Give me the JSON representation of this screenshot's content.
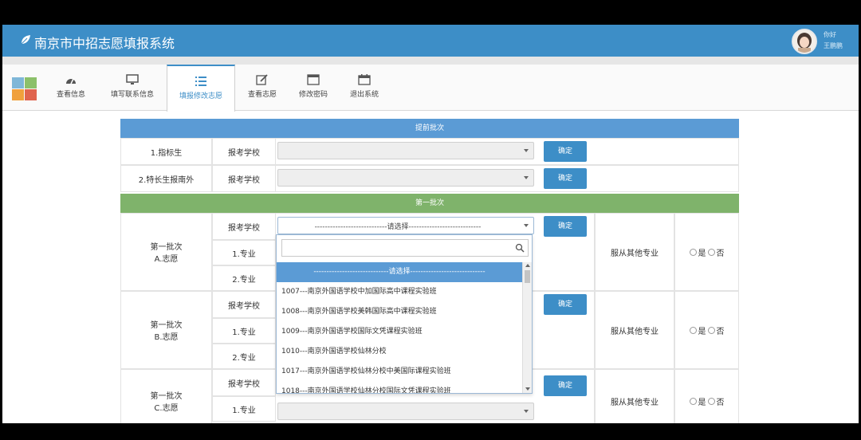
{
  "app": {
    "title": "南京市中招志愿填报系统",
    "user_line1": "你好",
    "user_line2": "王鹏鹏"
  },
  "nav": {
    "items": [
      {
        "label": "查看信息",
        "icon": "dashboard-icon"
      },
      {
        "label": "填写联系信息",
        "icon": "monitor-icon"
      },
      {
        "label": "填报修改志愿",
        "icon": "list-icon"
      },
      {
        "label": "查看志愿",
        "icon": "edit-icon"
      },
      {
        "label": "修改密码",
        "icon": "window-icon"
      },
      {
        "label": "退出系统",
        "icon": "calendar-icon"
      }
    ],
    "active_index": 2
  },
  "sections": {
    "advance": {
      "title": "提前批次",
      "rows": [
        {
          "label": "1.指标生",
          "field_label": "报考学校",
          "value": "",
          "button": "确定"
        },
        {
          "label": "2.特长生报南外",
          "field_label": "报考学校",
          "value": "",
          "button": "确定"
        }
      ]
    },
    "first_batch": {
      "title": "第一批次",
      "groups": [
        {
          "label_line1": "第一批次",
          "label_line2": "A.志愿",
          "school_label": "报考学校",
          "school_value": "----------------------------请选择----------------------------",
          "major1_label": "1.专业",
          "major2_label": "2.专业",
          "button": "确定",
          "obey_label": "服从其他专业",
          "yes": "是",
          "no": "否"
        },
        {
          "label_line1": "第一批次",
          "label_line2": "B.志愿",
          "school_label": "报考学校",
          "major1_label": "1.专业",
          "major2_label": "2.专业",
          "button": "确定",
          "obey_label": "服从其他专业",
          "yes": "是",
          "no": "否"
        },
        {
          "label_line1": "第一批次",
          "label_line2": "C.志愿",
          "school_label": "报考学校",
          "major1_label": "1.专业",
          "button": "确定",
          "obey_label": "服从其他专业",
          "yes": "是",
          "no": "否"
        }
      ]
    }
  },
  "dropdown": {
    "search_value": "",
    "options": [
      "-----------------------------请选择-----------------------------",
      "1007---南京外国语学校中加国际高中课程实验班",
      "1008---南京外国语学校美韩国际高中课程实验班",
      "1009---南京外国语学校国际文凭课程实验班",
      "1010---南京外国语学校仙林分校",
      "1017---南京外国语学校仙林分校中美国际课程实验班",
      "1018---南京外国语学校仙林分校国际文凭课程实验班"
    ],
    "highlighted_index": 0
  },
  "colors": {
    "header": "#3d8ec7",
    "band_blue": "#5b9bd5",
    "band_green": "#7fb36b",
    "button": "#3d8ec7"
  }
}
